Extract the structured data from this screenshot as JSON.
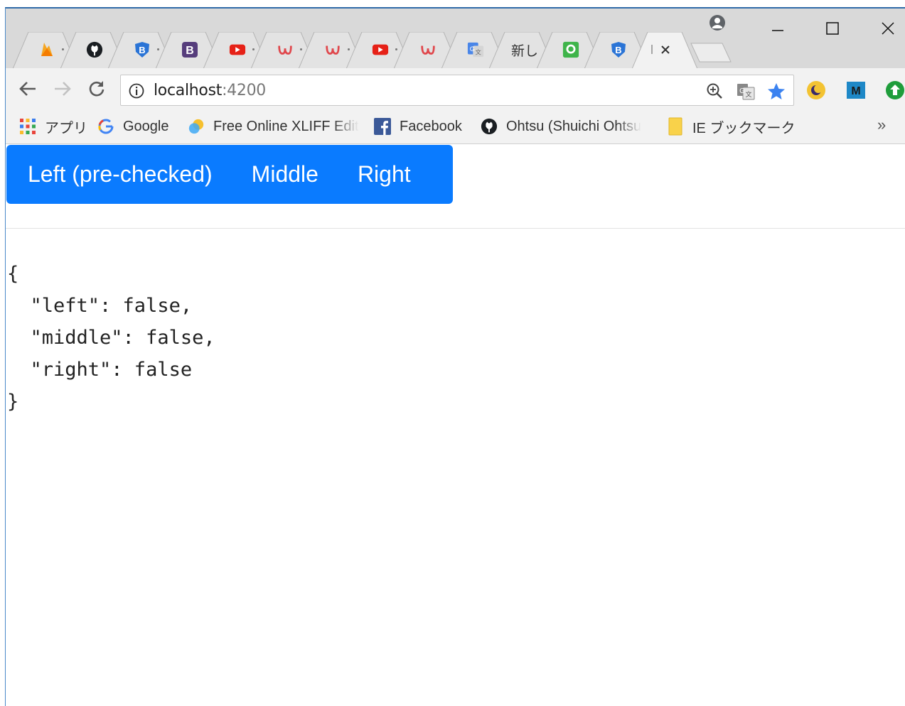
{
  "browser": {
    "tabs": [
      {
        "icon": "firebase-icon",
        "active": false
      },
      {
        "icon": "github-icon",
        "active": false
      },
      {
        "icon": "bootstrap-shield-icon",
        "active": false
      },
      {
        "icon": "bootstrap-icon",
        "active": false
      },
      {
        "icon": "youtube-icon",
        "active": false
      },
      {
        "icon": "udemy-icon",
        "active": false
      },
      {
        "icon": "udemy-icon",
        "active": false
      },
      {
        "icon": "youtube-icon",
        "active": false
      },
      {
        "icon": "udemy-icon",
        "active": false
      },
      {
        "icon": "google-translate-icon",
        "active": false
      },
      {
        "label": "新し",
        "active": false
      },
      {
        "icon": "green-app-icon",
        "active": false
      },
      {
        "icon": "bootstrap-shield-icon",
        "active": false
      },
      {
        "label": "I",
        "active": true
      }
    ],
    "address_bar": {
      "host": "localhost",
      "port": ":4200"
    },
    "bookmarks": [
      {
        "icon": "apps-grid-icon",
        "label": "アプリ"
      },
      {
        "icon": "google-g-icon",
        "label": "Google"
      },
      {
        "icon": "xliff-icon",
        "label": "Free Online XLIFF Edit"
      },
      {
        "icon": "facebook-icon",
        "label": "Facebook"
      },
      {
        "icon": "github-icon",
        "label": "Ohtsu (Shuichi Ohtsu"
      },
      {
        "icon": "folder-icon",
        "label": "IE ブックマーク"
      }
    ],
    "more_bookmarks": "»"
  },
  "page": {
    "buttons": [
      "Left (pre-checked)",
      "Middle",
      "Right"
    ],
    "json_output": "{\n  \"left\": false,\n  \"middle\": false,\n  \"right\": false\n}"
  },
  "colors": {
    "button_group": "#0a7bff",
    "tab_strip": "#d9d9d9",
    "toolbar": "#f2f2f2"
  }
}
